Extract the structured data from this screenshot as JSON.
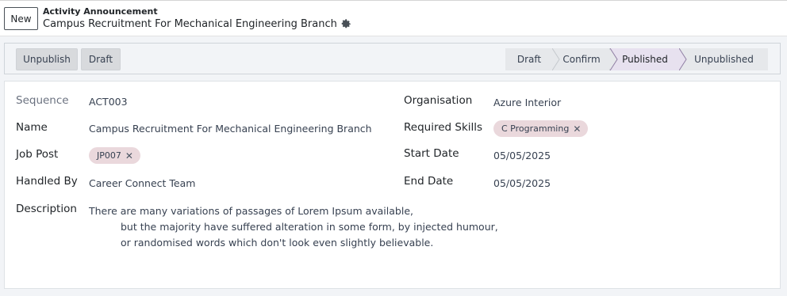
{
  "header": {
    "new_label": "New",
    "parent": "Activity Announcement",
    "title": "Campus Recruitment For Mechanical Engineering Branch",
    "gear_icon": "gear-icon"
  },
  "actions": {
    "unpublish_label": "Unpublish",
    "draft_label": "Draft"
  },
  "stages": {
    "items": [
      "Draft",
      "Confirm",
      "Published",
      "Unpublished"
    ],
    "active": "Published"
  },
  "form": {
    "sequence": {
      "label": "Sequence",
      "value": "ACT003"
    },
    "name": {
      "label": "Name",
      "value": "Campus Recruitment For Mechanical Engineering Branch"
    },
    "job_post": {
      "label": "Job Post",
      "tag": "JP007"
    },
    "handled_by": {
      "label": "Handled By",
      "value": "Career Connect Team"
    },
    "description": {
      "label": "Description",
      "lines": [
        "There are many variations of passages of Lorem Ipsum available,",
        "but the majority have suffered alteration in some form, by injected humour,",
        "or randomised words which don't look even slightly believable."
      ]
    },
    "organisation": {
      "label": "Organisation",
      "value": "Azure Interior"
    },
    "required_skills": {
      "label": "Required Skills",
      "tag": "C Programming"
    },
    "start_date": {
      "label": "Start Date",
      "value": "05/05/2025"
    },
    "end_date": {
      "label": "End Date",
      "value": "05/05/2025"
    }
  },
  "colors": {
    "tag_bg": "#ead8dc",
    "active_stage_bg": "#e7e1ef",
    "stage_bg": "#e6e8eb",
    "button_bg": "#d8dadd"
  }
}
